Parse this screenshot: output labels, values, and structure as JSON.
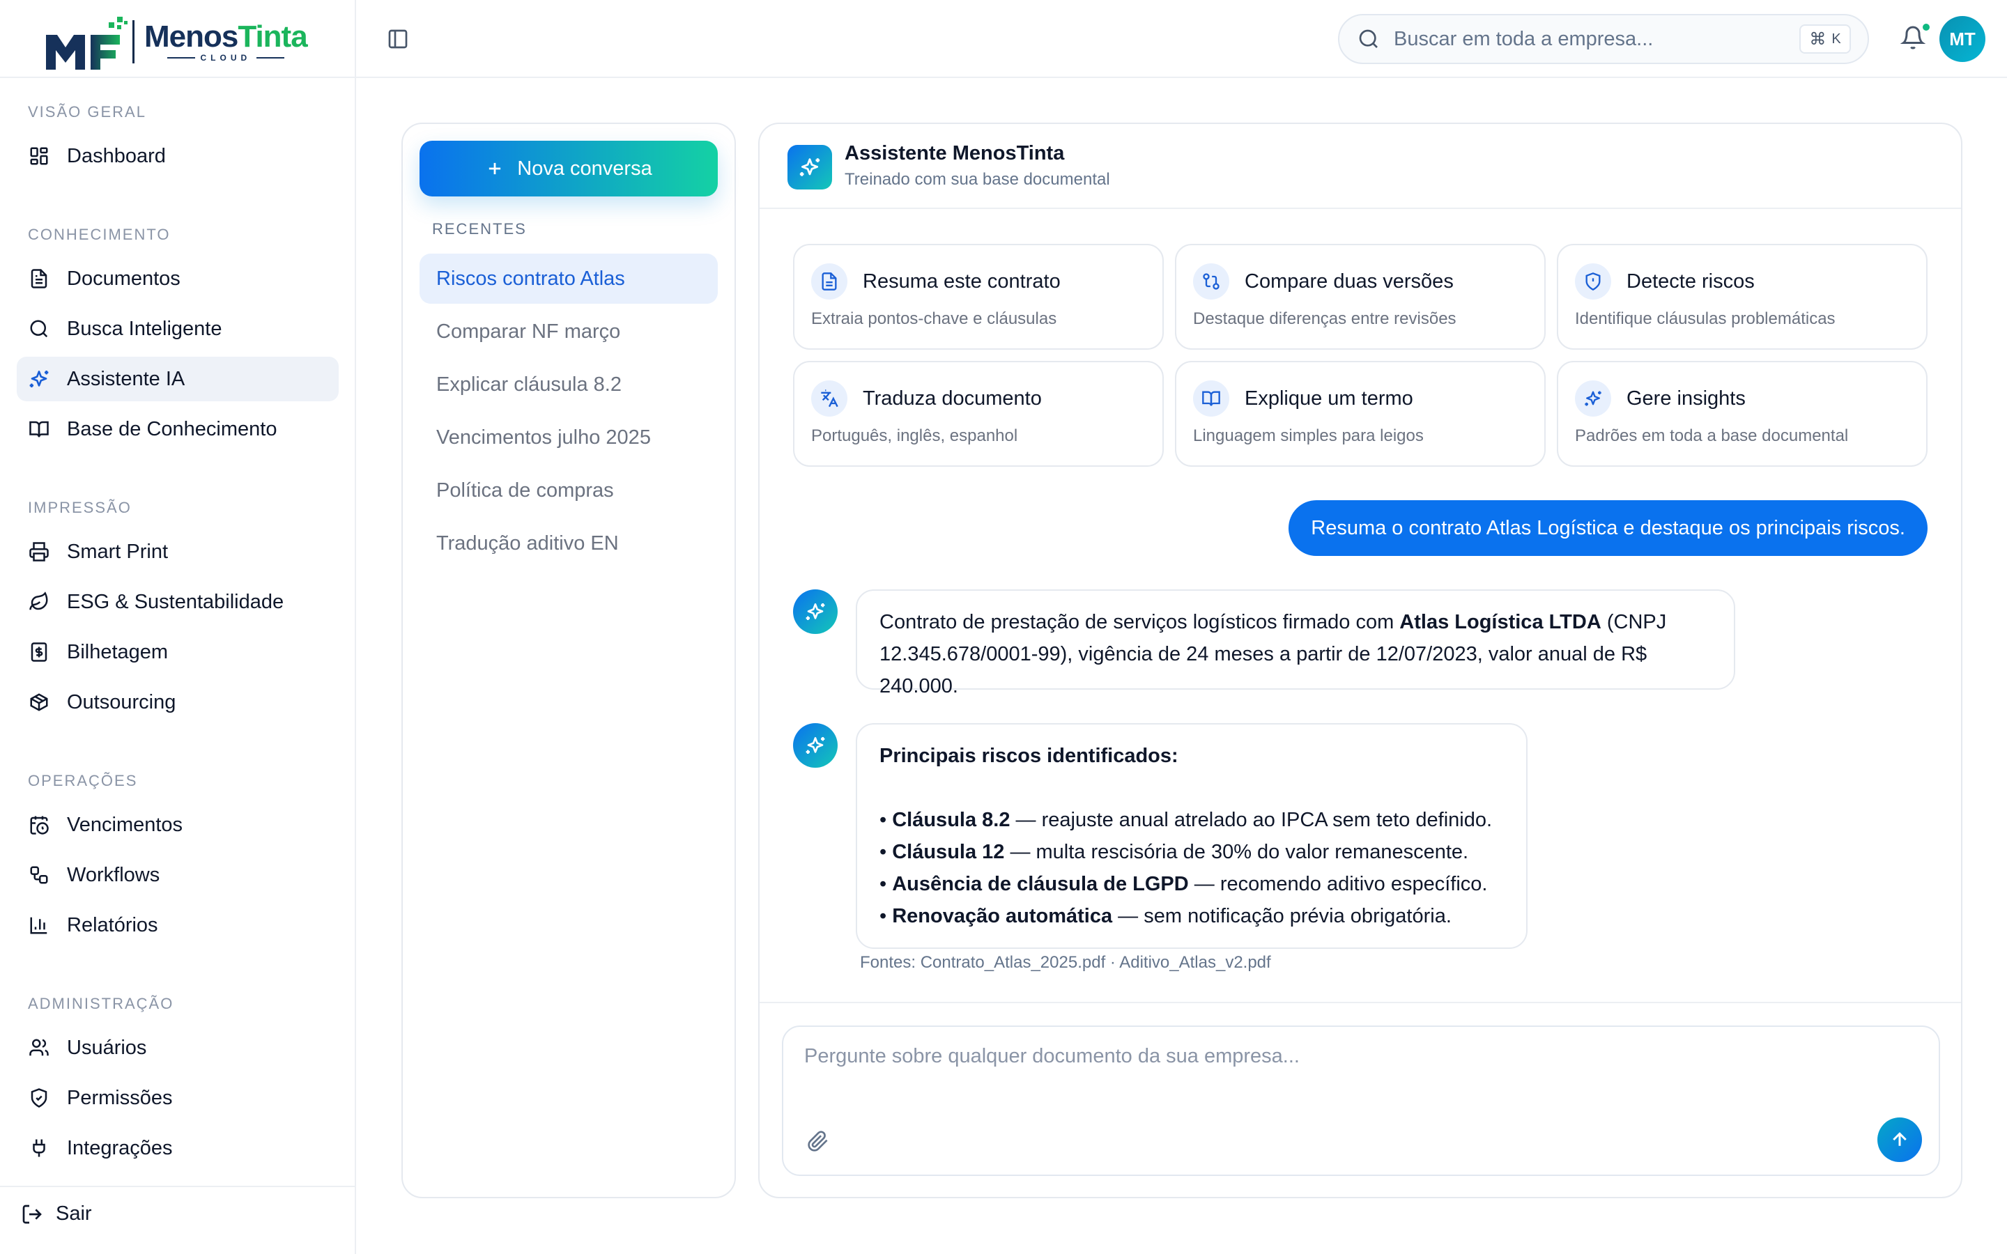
{
  "brand": {
    "name_part1": "Menos",
    "name_part2": "Tinta",
    "subtitle": "CLOUD"
  },
  "sidebar": {
    "sections": [
      {
        "title": "VISÃO GERAL",
        "items": [
          {
            "label": "Dashboard",
            "icon": "dashboard-icon"
          }
        ]
      },
      {
        "title": "CONHECIMENTO",
        "items": [
          {
            "label": "Documentos",
            "icon": "document-icon"
          },
          {
            "label": "Busca Inteligente",
            "icon": "search-icon"
          },
          {
            "label": "Assistente IA",
            "icon": "sparkles-icon",
            "active": true
          },
          {
            "label": "Base de Conhecimento",
            "icon": "book-icon"
          }
        ]
      },
      {
        "title": "IMPRESSÃO",
        "items": [
          {
            "label": "Smart Print",
            "icon": "printer-icon"
          },
          {
            "label": "ESG & Sustentabilidade",
            "icon": "leaf-icon"
          },
          {
            "label": "Bilhetagem",
            "icon": "receipt-icon"
          },
          {
            "label": "Outsourcing",
            "icon": "package-icon"
          }
        ]
      },
      {
        "title": "OPERAÇÕES",
        "items": [
          {
            "label": "Vencimentos",
            "icon": "calendar-clock-icon"
          },
          {
            "label": "Workflows",
            "icon": "workflow-icon"
          },
          {
            "label": "Relatórios",
            "icon": "bar-chart-icon"
          }
        ]
      },
      {
        "title": "ADMINISTRAÇÃO",
        "items": [
          {
            "label": "Usuários",
            "icon": "users-icon"
          },
          {
            "label": "Permissões",
            "icon": "shield-icon"
          },
          {
            "label": "Integrações",
            "icon": "plug-icon"
          }
        ]
      }
    ],
    "logout_label": "Sair"
  },
  "header": {
    "search_placeholder": "Buscar em toda a empresa...",
    "shortcut_symbol": "⌘",
    "shortcut_key": "K",
    "avatar_initials": "MT",
    "notification_dot_color": "#10b981"
  },
  "conversations": {
    "new_button": "Nova conversa",
    "recent_title": "RECENTES",
    "items": [
      "Riscos contrato Atlas",
      "Comparar NF março",
      "Explicar cláusula 8.2",
      "Vencimentos julho 2025",
      "Política de compras",
      "Tradução aditivo EN"
    ]
  },
  "chat": {
    "title": "Assistente MenosTinta",
    "subtitle": "Treinado com sua base documental",
    "suggestions": [
      {
        "title": "Resuma este contrato",
        "desc": "Extraia pontos-chave e cláusulas",
        "icon": "file-text-icon"
      },
      {
        "title": "Compare duas versões",
        "desc": "Destaque diferenças entre revisões",
        "icon": "compare-icon"
      },
      {
        "title": "Detecte riscos",
        "desc": "Identifique cláusulas problemáticas",
        "icon": "shield-alert-icon"
      },
      {
        "title": "Traduza documento",
        "desc": "Português, inglês, espanhol",
        "icon": "translate-icon"
      },
      {
        "title": "Explique um termo",
        "desc": "Linguagem simples para leigos",
        "icon": "book-open-icon"
      },
      {
        "title": "Gere insights",
        "desc": "Padrões em toda a base documental",
        "icon": "sparkles-icon"
      }
    ],
    "user_message": "Resuma o contrato Atlas Logística e destaque os principais riscos.",
    "reply1": {
      "pre": "Contrato de prestação de serviços logísticos firmado com ",
      "bold": "Atlas Logística LTDA",
      "post1": " (CNPJ",
      "line2": "12.345.678/0001-99), vigência de 24 meses a partir de 12/07/2023, valor anual de R$ 240.000."
    },
    "reply2": {
      "heading": "Principais riscos identificados:",
      "risks": [
        {
          "bold": "Cláusula 8.2",
          "text": " — reajuste anual atrelado ao IPCA sem teto definido."
        },
        {
          "bold": "Cláusula 12",
          "text": " — multa rescisória de 30% do valor remanescente."
        },
        {
          "bold": "Ausência de cláusula de LGPD",
          "text": " — recomendo aditivo específico."
        },
        {
          "bold": "Renovação automática",
          "text": " — sem notificação prévia obrigatória."
        }
      ]
    },
    "sources": "Fontes: Contrato_Atlas_2025.pdf · Aditivo_Atlas_v2.pdf",
    "input_placeholder": "Pergunte sobre qualquer documento da sua empresa..."
  },
  "colors": {
    "primary": "#0a72ee",
    "accent": "#14d1a4",
    "brand_green": "#1bb55c",
    "brand_navy": "#16315a"
  }
}
